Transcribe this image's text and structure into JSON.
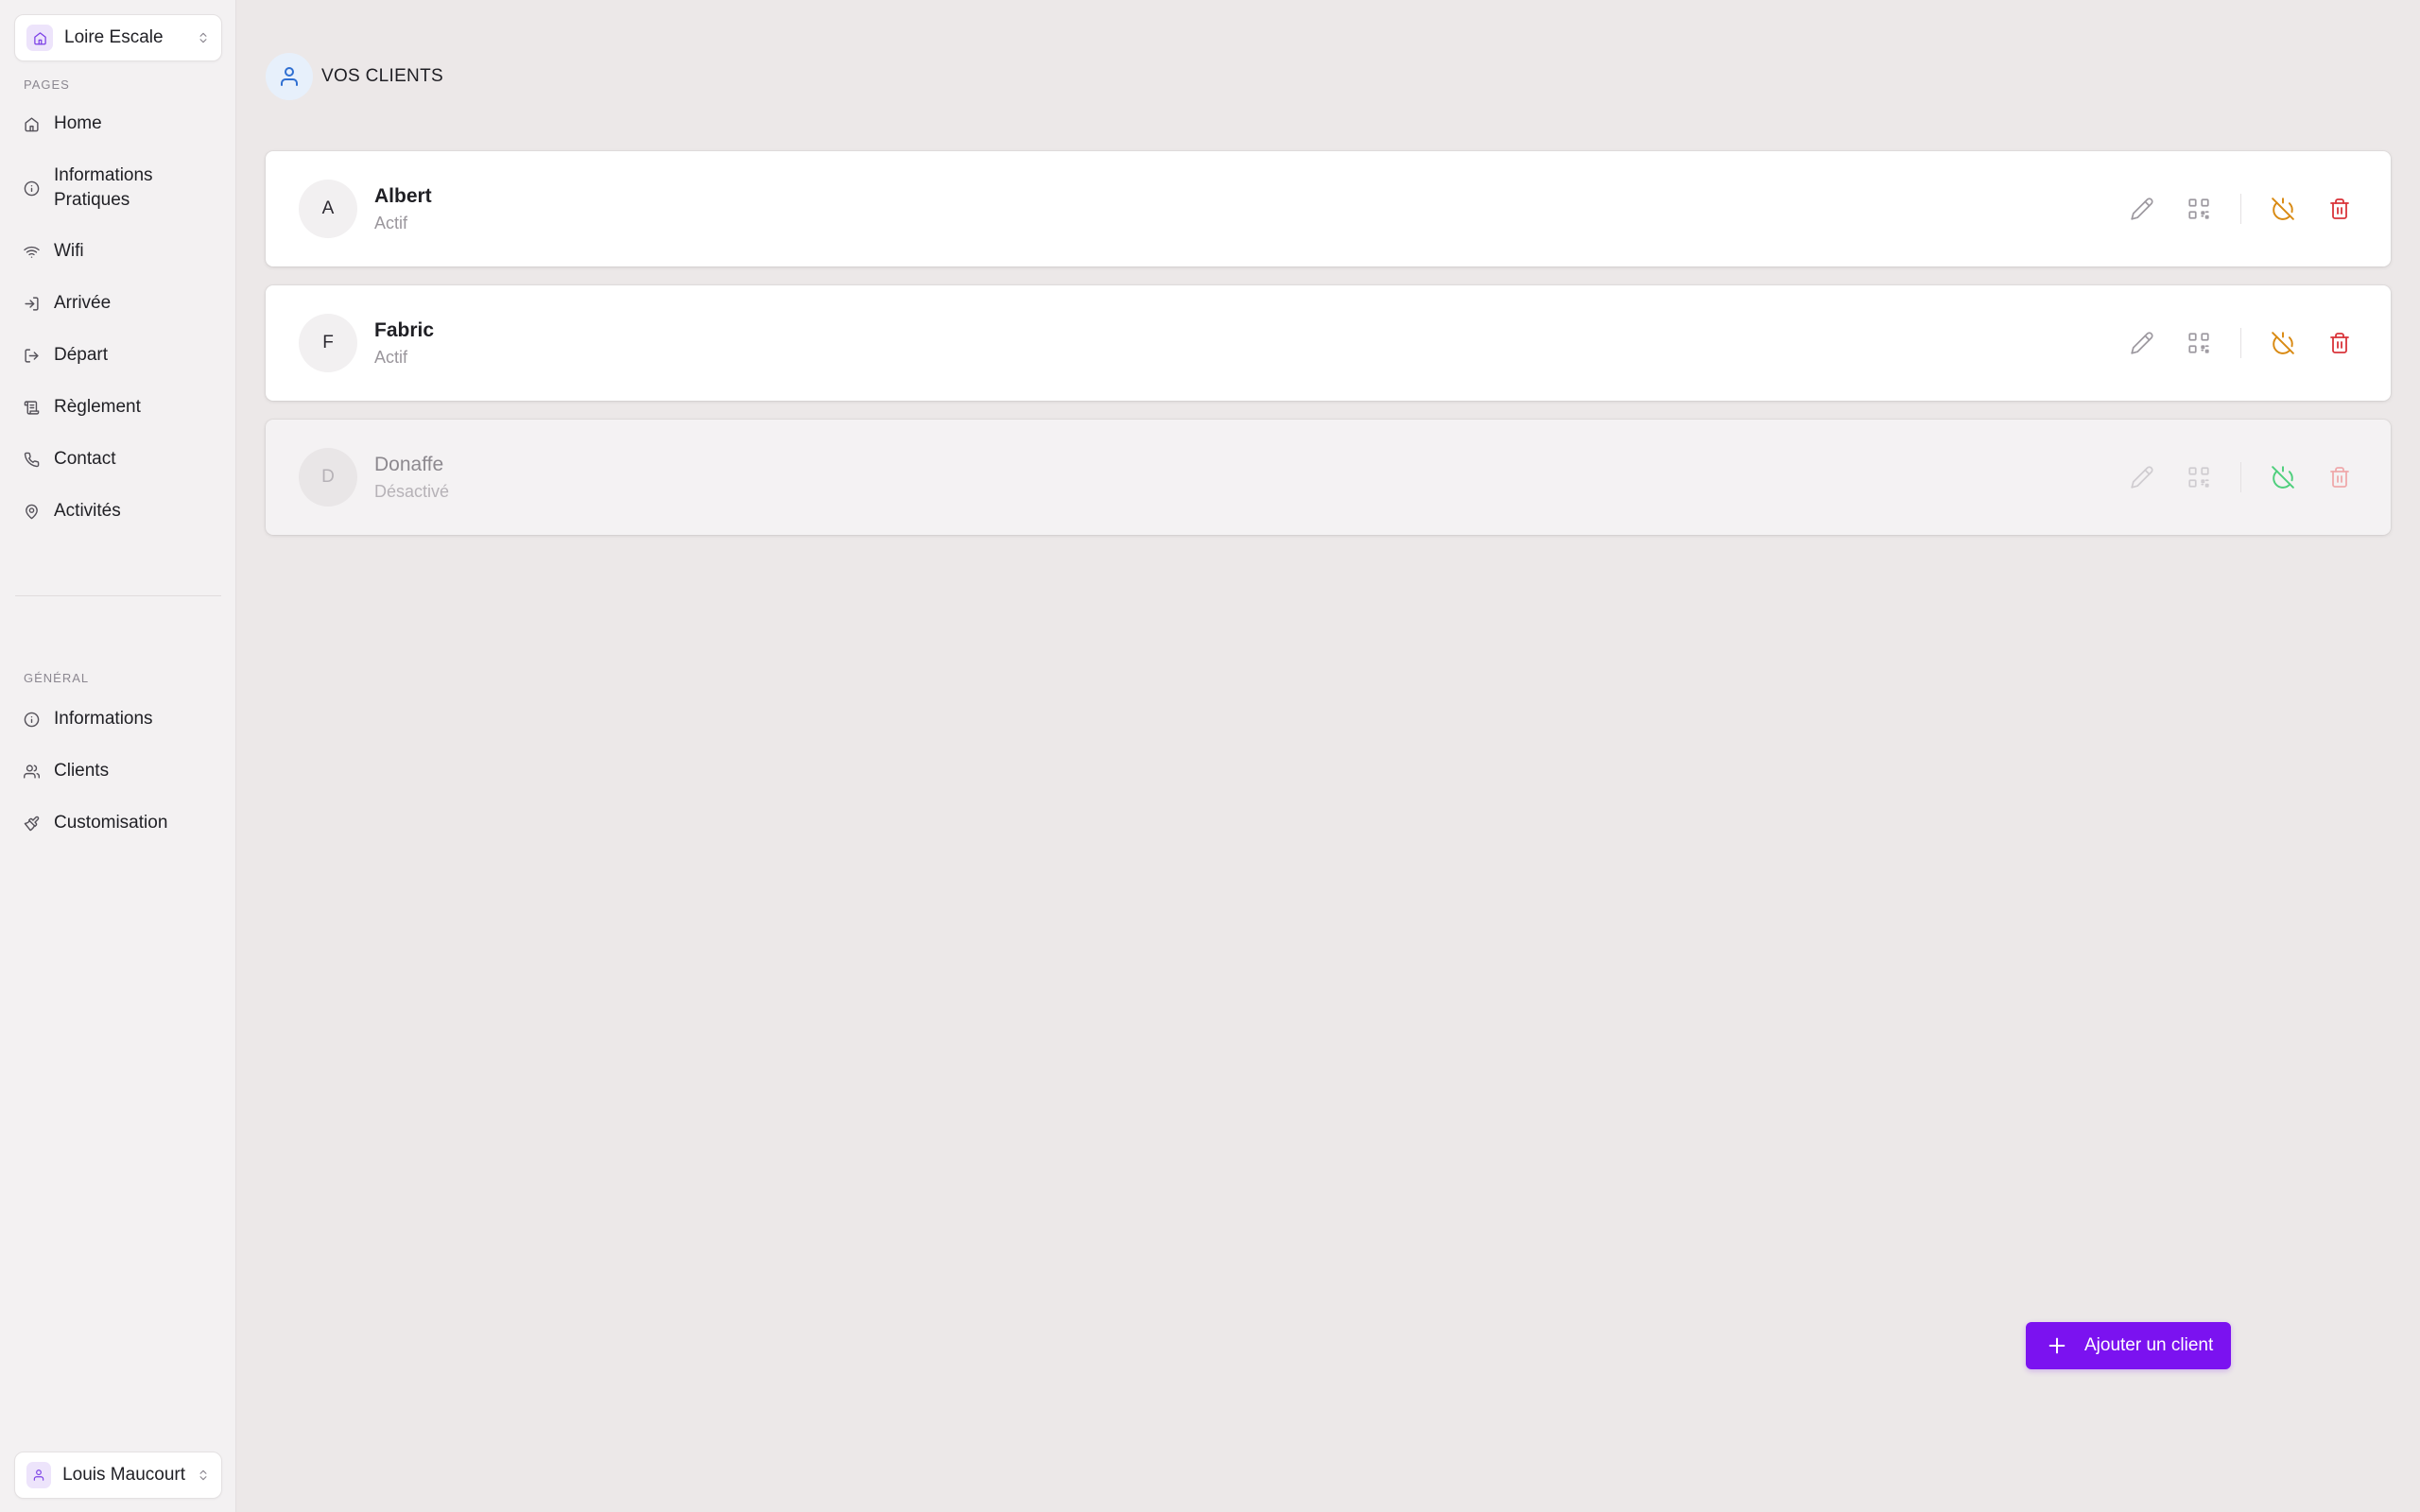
{
  "workspace": {
    "name": "Loire Escale"
  },
  "sidebar": {
    "pages_label": "PAGES",
    "pages": [
      {
        "label": "Home",
        "icon": "home-icon"
      },
      {
        "label": "Informations Pratiques",
        "icon": "info-icon"
      },
      {
        "label": "Wifi",
        "icon": "wifi-icon"
      },
      {
        "label": "Arrivée",
        "icon": "login-icon"
      },
      {
        "label": "Départ",
        "icon": "logout-icon"
      },
      {
        "label": "Règlement",
        "icon": "scroll-icon"
      },
      {
        "label": "Contact",
        "icon": "phone-icon"
      },
      {
        "label": "Activités",
        "icon": "map-pin-icon"
      }
    ],
    "general_label": "GÉNÉRAL",
    "general": [
      {
        "label": "Informations",
        "icon": "info-icon"
      },
      {
        "label": "Clients",
        "icon": "users-icon"
      },
      {
        "label": "Customisation",
        "icon": "brush-icon"
      }
    ]
  },
  "user": {
    "name": "Louis Maucourt"
  },
  "main": {
    "title": "VOS CLIENTS",
    "clients": [
      {
        "initial": "A",
        "name": "Albert",
        "status": "Actif",
        "active": true
      },
      {
        "initial": "F",
        "name": "Fabric",
        "status": "Actif",
        "active": true
      },
      {
        "initial": "D",
        "name": "Donaffe",
        "status": "Désactivé",
        "active": false
      }
    ],
    "add_button_label": "Ajouter un client"
  },
  "colors": {
    "accent": "#7b12f0",
    "toggle_active": "#d98a13",
    "toggle_inactive": "#4fcf7d",
    "delete": "#d9343a"
  }
}
